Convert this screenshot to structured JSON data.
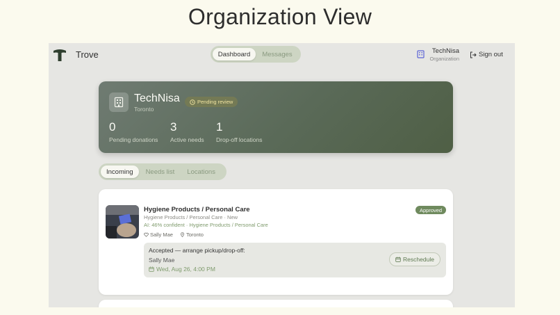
{
  "page": {
    "title": "Organization View"
  },
  "topbar": {
    "brand": "Trove",
    "nav": [
      {
        "label": "Dashboard",
        "active": true
      },
      {
        "label": "Messages",
        "active": false
      }
    ],
    "org_name": "TechNisa",
    "org_role": "Organization",
    "sign_out": "Sign out"
  },
  "hero": {
    "name": "TechNisa",
    "city": "Toronto",
    "badge": "Pending review",
    "stats": [
      {
        "value": "0",
        "label": "Pending donations"
      },
      {
        "value": "3",
        "label": "Active needs"
      },
      {
        "value": "1",
        "label": "Drop-off locations"
      }
    ]
  },
  "tabs": [
    {
      "label": "Incoming",
      "active": true
    },
    {
      "label": "Needs list",
      "active": false
    },
    {
      "label": "Locations",
      "active": false
    }
  ],
  "donation": {
    "title": "Hygiene Products / Personal Care",
    "subtitle": "Hygiene Products / Personal Care · New",
    "ai": "AI: 46% confident · Hygiene Products / Personal Care",
    "donor": "Sally Mae",
    "location": "Toronto",
    "status": "Approved",
    "accepted_title": "Accepted — arrange pickup/drop-off:",
    "accepted_name": "Sally Mae",
    "accepted_date": "Wed, Aug 26, 4:00 PM",
    "reschedule": "Reschedule"
  },
  "colors": {
    "accent": "#6f8a5e",
    "hero": "#5a6a58",
    "background": "#fbfaee"
  }
}
